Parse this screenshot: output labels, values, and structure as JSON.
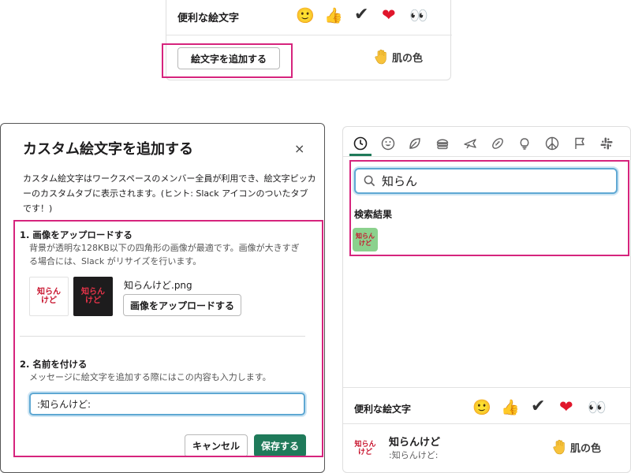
{
  "top_panel": {
    "frequent_label": "便利な絵文字",
    "frequent_emojis": [
      {
        "icon": "slightly-smiling-face-icon",
        "glyph": "🙂"
      },
      {
        "icon": "thumbs-up-icon",
        "glyph": "👍"
      },
      {
        "icon": "heavy-check-mark-icon",
        "glyph": "✔"
      },
      {
        "icon": "heart-icon",
        "glyph": "❤"
      },
      {
        "icon": "eyes-icon",
        "glyph": "👀"
      }
    ],
    "add_emoji_button": "絵文字を追加する",
    "skin_tone_label": "肌の色"
  },
  "dialog": {
    "title": "カスタム絵文字を追加する",
    "close_glyph": "×",
    "intro": "カスタム絵文字はワークスペースのメンバー全員が利用でき、絵文字ピッカーのカスタムタブに表示されます。(ヒント: Slack アイコンのついたタブです！)",
    "upload": {
      "title": "1. 画像をアップロードする",
      "description": "背景が透明な128KB以下の四角形の画像が最適です。画像が大きすぎる場合には、Slack がリサイズを行います。",
      "preview_text": "知らん\nけど",
      "file_name": "知らんけど.png",
      "upload_button": "画像をアップロードする"
    },
    "name": {
      "title": "2. 名前を付ける",
      "description": "メッセージに絵文字を追加する際にはこの内容も入力します。",
      "value": ":知らんけど:"
    },
    "cancel_button": "キャンセル",
    "save_button": "保存する"
  },
  "picker": {
    "tabs": [
      "clock-icon",
      "smiley-icon",
      "leaf-icon",
      "burger-icon",
      "airplane-icon",
      "football-icon",
      "lightbulb-icon",
      "peace-icon",
      "flag-icon",
      "slack-icon"
    ],
    "search_value": "知らん",
    "results_label": "検索結果",
    "result_tile_text": "知らん\nけど",
    "frequent_label": "便利な絵文字",
    "frequent_emojis": [
      {
        "icon": "slightly-smiling-face-icon",
        "glyph": "🙂"
      },
      {
        "icon": "thumbs-up-icon",
        "glyph": "👍"
      },
      {
        "icon": "heavy-check-mark-icon",
        "glyph": "✔"
      },
      {
        "icon": "heart-icon",
        "glyph": "❤"
      },
      {
        "icon": "eyes-icon",
        "glyph": "👀"
      }
    ],
    "preview_name": "知らんけど",
    "preview_code": ":知らんけど:",
    "skin_tone_label": "肌の色"
  },
  "colors": {
    "highlight": "#d6247d",
    "primary_green": "#1f7a5a",
    "emoji_tile_green": "#8bd18d",
    "emoji_text_red": "#c8142e",
    "focus_blue": "#5fa8d3"
  }
}
